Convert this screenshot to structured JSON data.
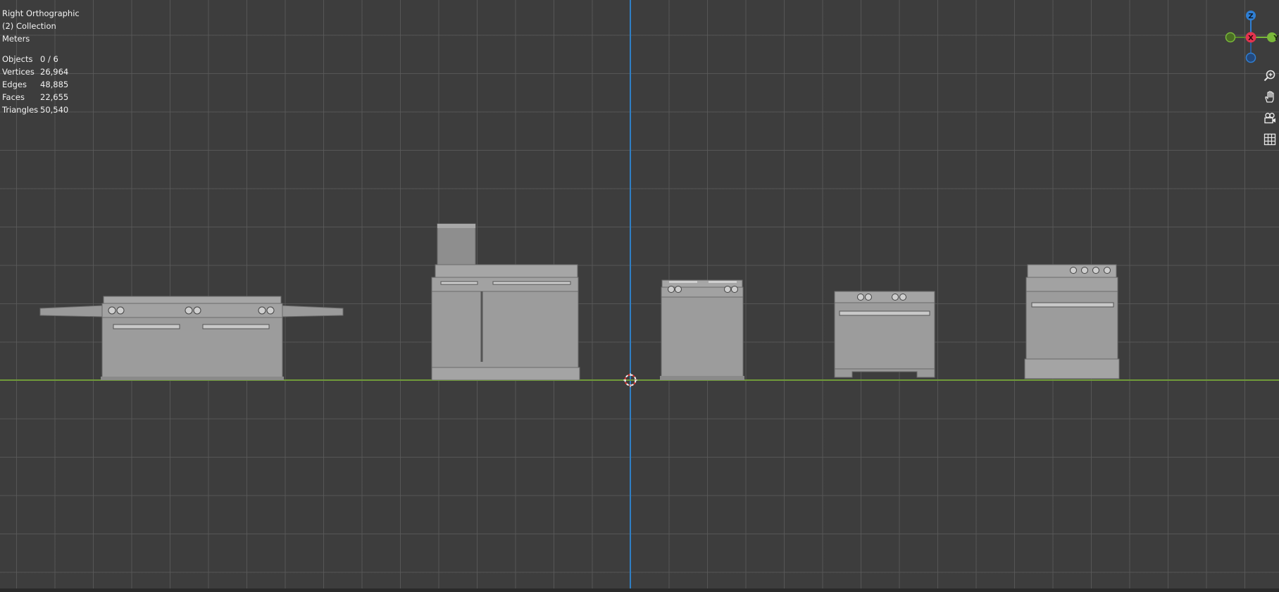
{
  "viewport": {
    "view_name": "Right Orthographic",
    "collection": "(2) Collection",
    "units": "Meters"
  },
  "stats": [
    {
      "label": "Objects",
      "value": "0 / 6"
    },
    {
      "label": "Vertices",
      "value": "26,964"
    },
    {
      "label": "Edges",
      "value": "48,885"
    },
    {
      "label": "Faces",
      "value": "22,655"
    },
    {
      "label": "Triangles",
      "value": "50,540"
    }
  ],
  "gizmo": {
    "z_label": "Z",
    "x_label": "X",
    "y_label": "Y",
    "colors": {
      "x": "#e3344f",
      "y": "#7ab83a",
      "z": "#2f7fd4",
      "y_neg": "#5a8a2a",
      "z_neg": "#2a5c9a"
    }
  },
  "tools": [
    {
      "name": "zoom",
      "icon": "zoom-in-icon"
    },
    {
      "name": "pan",
      "icon": "hand-icon"
    },
    {
      "name": "camera",
      "icon": "camera-icon"
    },
    {
      "name": "ortho-toggle",
      "icon": "grid-icon"
    }
  ],
  "colors": {
    "background": "#3d3d3d",
    "grid": "#5a5a5a",
    "axis_z": "#2f7fc4",
    "axis_y": "#6f9a39",
    "mesh": "#9c9c9c"
  }
}
